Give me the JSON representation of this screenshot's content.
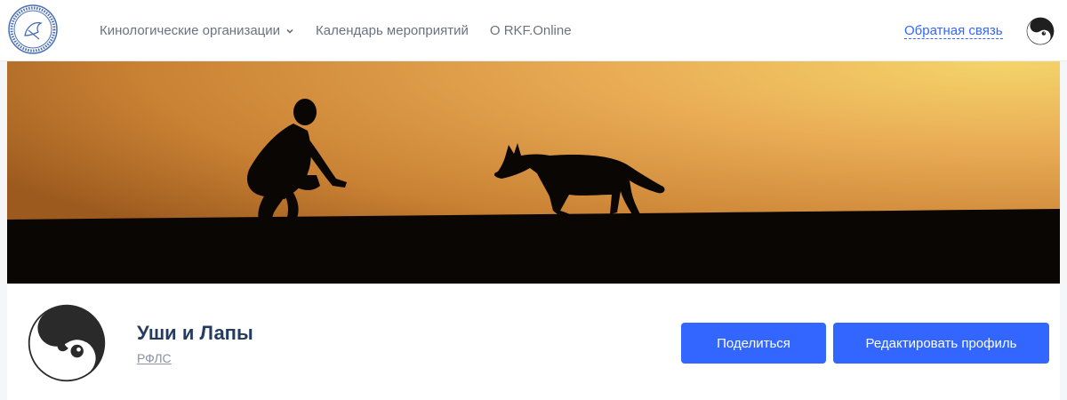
{
  "header": {
    "nav": [
      {
        "label": "Кинологические организации",
        "has_dropdown": true
      },
      {
        "label": "Календарь мероприятий"
      },
      {
        "label": "О RKF.Online"
      }
    ],
    "feedback_label": "Обратная связь",
    "logo_icon": "rkf-logo-icon",
    "user_avatar_icon": "yin-yang-dog-icon"
  },
  "banner": {
    "image": "sunset silhouette of crouching man and walking dog"
  },
  "profile": {
    "name": "Уши и Лапы",
    "organization": "РФЛС",
    "avatar_icon": "yin-yang-dog-icon",
    "share_label": "Поделиться",
    "edit_label": "Редактировать профиль"
  },
  "colors": {
    "accent": "#3366ff",
    "title": "#253c5e",
    "nav_text": "#6b7280"
  }
}
